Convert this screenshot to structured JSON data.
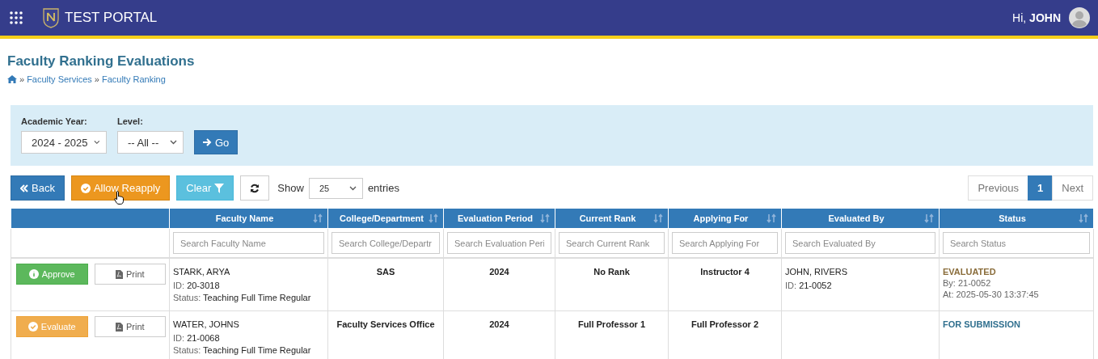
{
  "header": {
    "title": "TEST PORTAL",
    "greeting": "Hi, **JOHN**"
  },
  "page": {
    "title": "Faculty Ranking Evaluations",
    "breadcrumb": [
      {
        "separator": "»",
        "label": "Faculty Services"
      },
      {
        "separator": "»",
        "label": "Faculty Ranking"
      }
    ]
  },
  "filters": [
    {
      "label": "Academic Year:",
      "value": "2024 - 2025"
    },
    {
      "label": "Level:",
      "value": "-- All --"
    }
  ],
  "go_button": "Go",
  "toolbar": {
    "back": "Back",
    "allow_reapply": "Allow Reapply",
    "clear": "Clear",
    "show_label": "Show",
    "page_size": "25",
    "entries_label": "entries"
  },
  "pagination": [
    {
      "label": "Previous",
      "selected": false
    },
    {
      "label": "1",
      "selected": true
    },
    {
      "label": "Next",
      "selected": false
    }
  ],
  "table": {
    "columns": [
      "Faculty Name",
      "College/Department",
      "Evaluation Period",
      "Current Rank",
      "Applying For",
      "Evaluated By",
      "Status"
    ],
    "search_placeholders": [
      "Search Faculty Name",
      "Search College/Departr",
      "Search Evaluation Peri",
      "Search Current Rank",
      "Search Applying For",
      "Search Evaluated By",
      "Search Status"
    ],
    "rows": [
      {
        "action": {
          "kind": "approve",
          "label": "Approve"
        },
        "print": "Print",
        "name": "STARK, ARYA",
        "id": "ID: **20-3018**",
        "status_line": "Status: **Teaching Full Time Regular**",
        "college": "SAS",
        "period": "2024",
        "current_rank": "No Rank",
        "applying_for": "Instructor 4",
        "evaluator": {
          "name": "JOHN, RIVERS",
          "id": "ID: **21-0052**"
        },
        "status": {
          "kind": "evaluated",
          "label": "EVALUATED",
          "details": [
            "By: 21-0052",
            "At: 2025-05-30 13:37:45"
          ]
        }
      },
      {
        "action": {
          "kind": "evaluate",
          "label": "Evaluate"
        },
        "print": "Print",
        "name": "WATER, JOHNS",
        "id": "ID: **21-0068**",
        "status_line": "Status: **Teaching Full Time Regular**",
        "college": "Faculty Services Office",
        "period": "2024",
        "current_rank": "Full Professor 1",
        "applying_for": "Full Professor 2",
        "status": {
          "kind": "for_submission",
          "label": "FOR SUBMISSION"
        }
      }
    ]
  }
}
